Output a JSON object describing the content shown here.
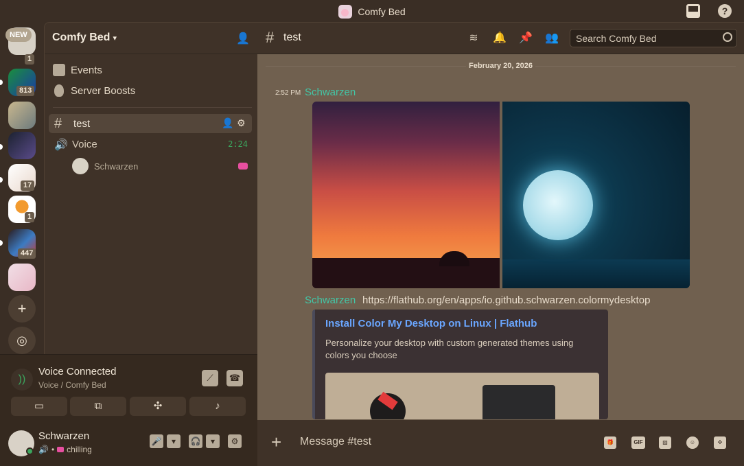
{
  "window": {
    "title": "Comfy Bed"
  },
  "rail": {
    "new_badge": "NEW",
    "servers": [
      {
        "badge": "1"
      },
      {
        "badge": "813"
      },
      {
        "badge": ""
      },
      {
        "badge": ""
      },
      {
        "badge": "17"
      },
      {
        "badge": "1"
      },
      {
        "badge": "447"
      },
      {
        "badge": ""
      }
    ]
  },
  "sidebar": {
    "server_name": "Comfy Bed",
    "events_label": "Events",
    "boosts_label": "Server Boosts",
    "text_channel": "test",
    "voice_channel": "Voice",
    "voice_time": "2:24",
    "voice_user": "Schwarzen"
  },
  "voice_panel": {
    "title": "Voice Connected",
    "subtitle": "Voice / Comfy Bed"
  },
  "user_panel": {
    "name": "Schwarzen",
    "separator": "•",
    "status": "chilling"
  },
  "main": {
    "channel_name": "test",
    "search_placeholder": "Search Comfy Bed",
    "date_separator": "February 20, 2026",
    "message1": {
      "time": "2:52 PM",
      "author": "Schwarzen"
    },
    "message2": {
      "author": "Schwarzen",
      "link": "https://flathub.org/en/apps/io.github.schwarzen.colormydesktop",
      "embed_title": "Install Color My Desktop on Linux | Flathub",
      "embed_description": "Personalize your desktop with custom generated themes using colors you choose"
    },
    "composer_placeholder": "Message #test",
    "gif_label": "GIF"
  },
  "colors": {
    "accent_green": "#3ba55d",
    "author_teal": "#43c6a6",
    "link_blue": "#6aa6ff",
    "background": "#70604f"
  }
}
